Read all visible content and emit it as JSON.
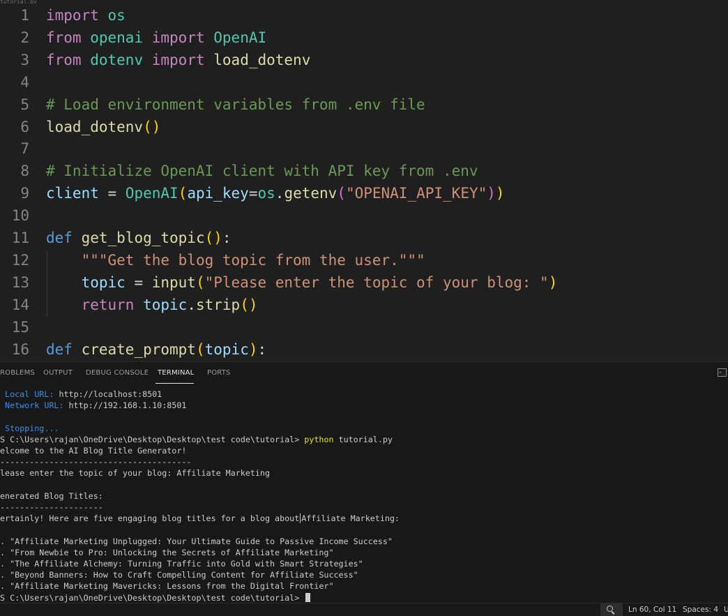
{
  "editor": {
    "tab_sliver": "tutorial.py",
    "lines": [
      {
        "num": "1",
        "tokens": [
          {
            "c": "kw-ctrl",
            "t": "import"
          },
          {
            "c": "punc",
            "t": " "
          },
          {
            "c": "mod",
            "t": "os"
          }
        ]
      },
      {
        "num": "2",
        "tokens": [
          {
            "c": "kw-ctrl",
            "t": "from"
          },
          {
            "c": "punc",
            "t": " "
          },
          {
            "c": "mod",
            "t": "openai"
          },
          {
            "c": "punc",
            "t": " "
          },
          {
            "c": "kw-ctrl",
            "t": "import"
          },
          {
            "c": "punc",
            "t": " "
          },
          {
            "c": "mod",
            "t": "OpenAI"
          }
        ]
      },
      {
        "num": "3",
        "tokens": [
          {
            "c": "kw-ctrl",
            "t": "from"
          },
          {
            "c": "punc",
            "t": " "
          },
          {
            "c": "mod",
            "t": "dotenv"
          },
          {
            "c": "punc",
            "t": " "
          },
          {
            "c": "kw-ctrl",
            "t": "import"
          },
          {
            "c": "punc",
            "t": " "
          },
          {
            "c": "fn",
            "t": "load_dotenv"
          }
        ]
      },
      {
        "num": "4",
        "tokens": []
      },
      {
        "num": "5",
        "tokens": [
          {
            "c": "cmt",
            "t": "# Load environment variables from .env file"
          }
        ]
      },
      {
        "num": "6",
        "tokens": [
          {
            "c": "fn",
            "t": "load_dotenv"
          },
          {
            "c": "paren1",
            "t": "()"
          }
        ]
      },
      {
        "num": "7",
        "tokens": []
      },
      {
        "num": "8",
        "tokens": [
          {
            "c": "cmt",
            "t": "# Initialize OpenAI client with API key from .env"
          }
        ]
      },
      {
        "num": "9",
        "tokens": [
          {
            "c": "var",
            "t": "client"
          },
          {
            "c": "punc",
            "t": " = "
          },
          {
            "c": "mod",
            "t": "OpenAI"
          },
          {
            "c": "paren1",
            "t": "("
          },
          {
            "c": "var",
            "t": "api_key"
          },
          {
            "c": "punc",
            "t": "="
          },
          {
            "c": "mod",
            "t": "os"
          },
          {
            "c": "punc",
            "t": "."
          },
          {
            "c": "fn",
            "t": "getenv"
          },
          {
            "c": "paren2",
            "t": "("
          },
          {
            "c": "str",
            "t": "\"OPENAI_API_KEY\""
          },
          {
            "c": "paren2",
            "t": ")"
          },
          {
            "c": "paren1",
            "t": ")"
          }
        ]
      },
      {
        "num": "10",
        "tokens": []
      },
      {
        "num": "11",
        "tokens": [
          {
            "c": "kw-def",
            "t": "def"
          },
          {
            "c": "punc",
            "t": " "
          },
          {
            "c": "fn",
            "t": "get_blog_topic"
          },
          {
            "c": "paren1",
            "t": "()"
          },
          {
            "c": "punc",
            "t": ":"
          }
        ]
      },
      {
        "num": "12",
        "tokens": [
          {
            "c": "punc",
            "t": "    "
          },
          {
            "c": "str",
            "t": "\"\"\"Get the blog topic from the user.\"\"\""
          }
        ]
      },
      {
        "num": "13",
        "tokens": [
          {
            "c": "punc",
            "t": "    "
          },
          {
            "c": "var",
            "t": "topic"
          },
          {
            "c": "punc",
            "t": " = "
          },
          {
            "c": "fn",
            "t": "input"
          },
          {
            "c": "paren1",
            "t": "("
          },
          {
            "c": "str",
            "t": "\"Please enter the topic of your blog: \""
          },
          {
            "c": "paren1",
            "t": ")"
          }
        ]
      },
      {
        "num": "14",
        "tokens": [
          {
            "c": "punc",
            "t": "    "
          },
          {
            "c": "kw-ctrl",
            "t": "return"
          },
          {
            "c": "punc",
            "t": " "
          },
          {
            "c": "var",
            "t": "topic"
          },
          {
            "c": "punc",
            "t": "."
          },
          {
            "c": "fn",
            "t": "strip"
          },
          {
            "c": "paren1",
            "t": "()"
          }
        ]
      },
      {
        "num": "15",
        "tokens": []
      },
      {
        "num": "16",
        "tokens": [
          {
            "c": "kw-def",
            "t": "def"
          },
          {
            "c": "punc",
            "t": " "
          },
          {
            "c": "fn",
            "t": "create_prompt"
          },
          {
            "c": "paren1",
            "t": "("
          },
          {
            "c": "var",
            "t": "topic"
          },
          {
            "c": "paren1",
            "t": ")"
          },
          {
            "c": "punc",
            "t": ":"
          }
        ]
      }
    ]
  },
  "panel": {
    "tabs": [
      {
        "label": "ROBLEMS",
        "name": "tab-problems",
        "active": false
      },
      {
        "label": "OUTPUT",
        "name": "tab-output",
        "active": false
      },
      {
        "label": "DEBUG CONSOLE",
        "name": "tab-debug-console",
        "active": false
      },
      {
        "label": "TERMINAL",
        "name": "tab-terminal",
        "active": true
      },
      {
        "label": "PORTS",
        "name": "tab-ports",
        "active": false
      }
    ],
    "new_terminal_icon": "terminal-icon"
  },
  "terminal": {
    "lines": [
      {
        "segs": [
          {
            "c": "t-blue",
            "t": " Local URL: "
          },
          {
            "c": "",
            "t": "http://localhost:8501"
          }
        ]
      },
      {
        "segs": [
          {
            "c": "t-blue",
            "t": " Network URL: "
          },
          {
            "c": "",
            "t": "http://192.168.1.10:8501"
          }
        ]
      },
      {
        "segs": []
      },
      {
        "segs": [
          {
            "c": "t-blue",
            "t": " Stopping..."
          }
        ]
      },
      {
        "segs": [
          {
            "c": "",
            "t": "S C:\\Users\\rajan\\OneDrive\\Desktop\\Desktop\\test code\\tutorial> "
          },
          {
            "c": "t-yellow",
            "t": "python"
          },
          {
            "c": "",
            "t": " tutorial.py"
          }
        ]
      },
      {
        "segs": [
          {
            "c": "",
            "t": "elcome to the AI Blog Title Generator!"
          }
        ]
      },
      {
        "segs": [
          {
            "c": "",
            "t": "---------------------------------------"
          }
        ]
      },
      {
        "segs": [
          {
            "c": "",
            "t": "lease enter the topic of your blog: Affiliate Marketing"
          }
        ]
      },
      {
        "segs": []
      },
      {
        "segs": [
          {
            "c": "",
            "t": "enerated Blog Titles:"
          }
        ]
      },
      {
        "segs": [
          {
            "c": "",
            "t": "---------------------"
          }
        ]
      },
      {
        "segs": [
          {
            "c": "",
            "t": "ertainly! Here are five engaging blog titles for a blog about"
          },
          {
            "c": "ibeam",
            "t": ""
          },
          {
            "c": "",
            "t": "Affiliate Marketing:"
          }
        ]
      },
      {
        "segs": []
      },
      {
        "segs": [
          {
            "c": "",
            "t": ". \"Affiliate Marketing Unplugged: Your Ultimate Guide to Passive Income Success\""
          }
        ]
      },
      {
        "segs": [
          {
            "c": "",
            "t": ". \"From Newbie to Pro: Unlocking the Secrets of Affiliate Marketing\""
          }
        ]
      },
      {
        "segs": [
          {
            "c": "",
            "t": ". \"The Affiliate Alchemy: Turning Traffic into Gold with Smart Strategies\""
          }
        ]
      },
      {
        "segs": [
          {
            "c": "",
            "t": ". \"Beyond Banners: How to Craft Compelling Content for Affiliate Success\""
          }
        ]
      },
      {
        "segs": [
          {
            "c": "",
            "t": ". \"Affiliate Marketing Mavericks: Lessons from the Digital Frontier\""
          }
        ]
      },
      {
        "segs": [
          {
            "c": "",
            "t": "S C:\\Users\\rajan\\OneDrive\\Desktop\\Desktop\\test code\\tutorial> "
          },
          {
            "c": "cursor",
            "t": ""
          }
        ]
      }
    ]
  },
  "statusbar": {
    "zoom_icon": "zoom-icon",
    "position": "Ln 60, Col 11",
    "spaces": "Spaces: 4",
    "trailing": "U"
  }
}
